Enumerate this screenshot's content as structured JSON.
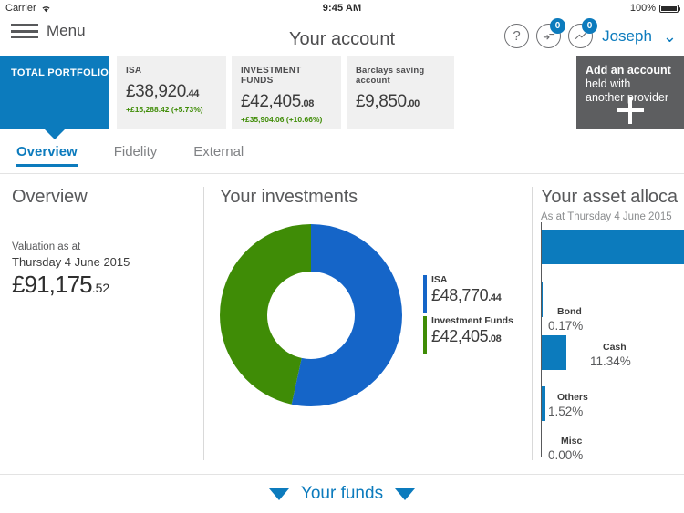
{
  "status_bar": {
    "carrier": "Carrier",
    "wifi_icon": "wifi-icon",
    "time": "9:45 AM",
    "battery_percent": "100%",
    "battery_icon": "battery-full-icon"
  },
  "topnav": {
    "menu_icon": "hamburger-icon",
    "menu_label": "Menu",
    "title": "Your account",
    "help_icon": "question-mark-icon",
    "messages_icon": "messages-icon",
    "messages_badge": "0",
    "activity_icon": "activity-icon",
    "activity_badge": "0",
    "user_name": "Joseph",
    "chevron_icon": "chevron-down-icon"
  },
  "accounts": {
    "total_tile_label": "TOTAL PORTFOLIO",
    "cards": [
      {
        "name": "ISA",
        "value_main": "£38,920",
        "value_dec": ".44",
        "delta": "+£15,288.42 (+5.73%)"
      },
      {
        "name": "INVESTMENT FUNDS",
        "value_main": "£42,405",
        "value_dec": ".08",
        "delta": "+£35,904.06 (+10.66%)"
      },
      {
        "name": "Barclays saving account",
        "value_main": "£9,850",
        "value_dec": ".00",
        "delta": ""
      }
    ],
    "add_account": {
      "line1": "Add an account",
      "line2": "held with",
      "line3": "another provider",
      "icon": "plus-icon"
    }
  },
  "tabs": [
    {
      "label": "Overview",
      "active": true
    },
    {
      "label": "Fidelity",
      "active": false
    },
    {
      "label": "External",
      "active": false
    }
  ],
  "overview_panel": {
    "title": "Overview",
    "valuation_label": "Valuation as at",
    "valuation_date": "Thursday 4 June 2015",
    "valuation_main": "£91,175",
    "valuation_dec": ".52"
  },
  "investments_panel": {
    "title": "Your investments",
    "legend": [
      {
        "name": "ISA",
        "value_main": "£48,770",
        "value_dec": ".44"
      },
      {
        "name": "Investment Funds",
        "value_main": "£42,405",
        "value_dec": ".08"
      }
    ]
  },
  "allocation_panel": {
    "title": "Your asset alloca",
    "subtitle": "As at Thursday 4 June 2015"
  },
  "footer": {
    "left_icon": "triangle-down-icon",
    "label": "Your funds",
    "right_icon": "triangle-down-icon"
  },
  "colors": {
    "brand_blue": "#0c7bbd",
    "donut_blue": "#1565c8",
    "donut_green": "#3f8c06",
    "gain_green": "#3f8c06",
    "card_grey": "#f0f0f0",
    "add_tile_grey": "#5d5e60"
  },
  "chart_data": [
    {
      "type": "pie",
      "title": "Your investments",
      "labels": [
        "ISA",
        "Investment Funds"
      ],
      "values": [
        48770.44,
        42405.08
      ],
      "value_labels": [
        "£48,770.44",
        "£42,405.08"
      ],
      "colors": [
        "#1565c8",
        "#3f8c06"
      ],
      "donut": true,
      "inner_radius_ratio": 0.52,
      "start_angle_deg": 0,
      "legend": "right"
    },
    {
      "type": "bar",
      "orientation": "horizontal",
      "title": "Your asset alloca",
      "subtitle": "As at Thursday 4 June 2015",
      "categories": [
        "",
        "Bond",
        "Cash",
        "Others",
        "Misc"
      ],
      "values": [
        86.97,
        0.17,
        11.34,
        1.52,
        0.0
      ],
      "value_labels": [
        "",
        "0.17%",
        "11.34%",
        "1.52%",
        "0.00%"
      ],
      "xlim": [
        0,
        100
      ],
      "bar_color": "#0c7bbd",
      "grid": false,
      "note": "first bar extends past the right edge of the visible screenshot"
    }
  ]
}
